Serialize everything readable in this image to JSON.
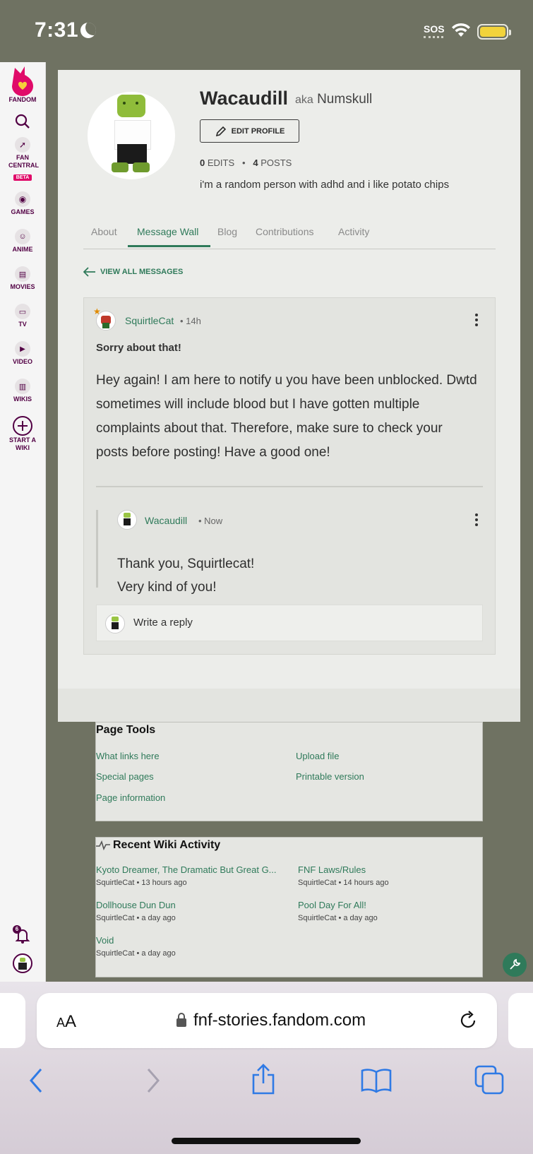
{
  "status": {
    "time": "7:31",
    "sos": "SOS"
  },
  "rail": {
    "logo": "FANDOM",
    "items": [
      {
        "label": "FAN CENTRAL",
        "badge": "BETA",
        "icon": "rocket-icon"
      },
      {
        "label": "GAMES",
        "icon": "gamepad-icon"
      },
      {
        "label": "ANIME",
        "icon": "anime-face-icon"
      },
      {
        "label": "MOVIES",
        "icon": "film-icon"
      },
      {
        "label": "TV",
        "icon": "tv-icon"
      },
      {
        "label": "VIDEO",
        "icon": "play-icon"
      },
      {
        "label": "WIKIS",
        "icon": "book-icon"
      },
      {
        "label": "START A WIKI",
        "icon": "plus-circle-icon"
      }
    ],
    "notifications_count": "6"
  },
  "profile": {
    "username": "Wacaudill",
    "aka_prefix": "aka",
    "aka": "Numskull",
    "edit_label": "EDIT PROFILE",
    "edits_count": "0",
    "edits_label": "EDITS",
    "sep": "•",
    "posts_count": "4",
    "posts_label": "POSTS",
    "bio": "i'm a random person with adhd and i like potato chips"
  },
  "tabs": [
    "About",
    "Message Wall",
    "Blog",
    "Contributions",
    "Activity"
  ],
  "active_tab": "Message Wall",
  "view_all_label": "VIEW ALL MESSAGES",
  "message": {
    "author": "SquirtleCat",
    "time": "• 14h",
    "title": "Sorry about that!",
    "body": "Hey again! I am here to notify u you have been unblocked. Dwtd sometimes will include blood but I have gotten multiple complaints about that. Therefore, make sure to check your posts before posting! Have a good one!",
    "reply": {
      "author": "Wacaudill",
      "time": "• Now",
      "line1": "Thank you, Squirtlecat!",
      "line2": "Very kind of you!"
    },
    "write_reply_placeholder": "Write a reply"
  },
  "page_tools": {
    "title": "Page Tools",
    "links_left": [
      "What links here",
      "Special pages",
      "Page information"
    ],
    "links_right": [
      "Upload file",
      "Printable version"
    ]
  },
  "recent_activity": {
    "title": "Recent Wiki Activity",
    "items": [
      {
        "page": "Kyoto Dreamer, The Dramatic But Great G...",
        "meta": "SquirtleCat • 13 hours ago"
      },
      {
        "page": "FNF Laws/Rules",
        "meta": "SquirtleCat • 14 hours ago"
      },
      {
        "page": "Dollhouse Dun Dun",
        "meta": "SquirtleCat • a day ago"
      },
      {
        "page": "Pool Day For All!",
        "meta": "SquirtleCat • a day ago"
      },
      {
        "page": "Void",
        "meta": "SquirtleCat • a day ago"
      }
    ]
  },
  "safari": {
    "text_size_small": "A",
    "text_size_large": "A",
    "url": "fnf-stories.fandom.com"
  },
  "colors": {
    "accent_green": "#2f7a5a",
    "fandom_pink": "#e00b69",
    "page_bg": "#6f7262"
  }
}
